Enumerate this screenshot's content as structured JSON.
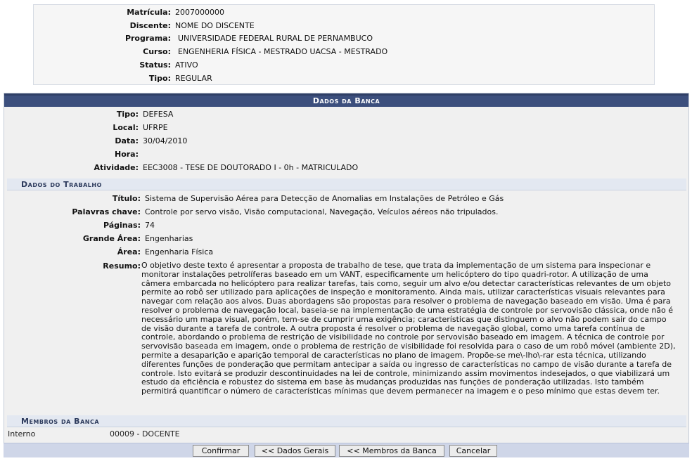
{
  "student": {
    "matricula_label": "Matrícula:",
    "matricula": "2007000000",
    "discente_label": "Discente:",
    "discente": "NOME DO DISCENTE",
    "programa_label": "Programa:",
    "programa": "UNIVERSIDADE FEDERAL RURAL DE PERNAMBUCO",
    "curso_label": "Curso:",
    "curso": "ENGENHERIA FÍSICA - MESTRADO UACSA - MESTRADO",
    "status_label": "Status:",
    "status": "ATIVO",
    "tipo_label": "Tipo:",
    "tipo": "REGULAR"
  },
  "banca": {
    "title": "Dados da Banca",
    "tipo_label": "Tipo:",
    "tipo": "DEFESA",
    "local_label": "Local:",
    "local": "UFRPE",
    "data_label": "Data:",
    "data": "30/04/2010",
    "hora_label": "Hora:",
    "hora": "",
    "atividade_label": "Atividade:",
    "atividade": "EEC3008 - TESE DE DOUTORADO I - 0h - MATRICULADO"
  },
  "trabalho": {
    "section_title": "Dados do Trabalho",
    "titulo_label": "Título:",
    "titulo": "Sistema de Supervisão Aérea para Detecção de Anomalias em Instalações de Petróleo e Gás",
    "palavras_label": "Palavras chave:",
    "palavras": "Controle por servo visão, Visão computacional, Navegação, Veículos aéreos não tripulados.",
    "paginas_label": "Páginas:",
    "paginas": "74",
    "grande_area_label": "Grande Área:",
    "grande_area": "Engenharias",
    "area_label": "Área:",
    "area": "Engenharia Física",
    "resumo_label": "Resumo:",
    "resumo": "O objetivo deste texto é apresentar a proposta de trabalho de tese, que trata da implementação de um sistema para inspecionar e monitorar instalações petrolíferas baseado em um VANT, especificamente um helicóptero do tipo quadri-rotor. A utilização de uma câmera embarcada no helicóptero para realizar tarefas, tais como, seguir um alvo e/ou detectar características relevantes de um objeto permite ao robô ser utilizado para aplicações de inspeção e monitoramento. Ainda mais, utilizar características visuais relevantes para navegar com relação aos alvos. Duas abordagens são propostas para resolver o problema de navegação baseado em visão. Uma é para resolver o problema de navegação local, baseia-se na implementação de uma estratégia de controle por servovisão clássica, onde não é necessário um mapa visual, porém, tem-se de cumprir uma exigência; características que distinguem o alvo não podem sair do campo de visão durante a tarefa de controle. A outra proposta é resolver o problema de navegação global, como uma tarefa contínua de controle, abordando o problema de restrição de visibilidade no controle por servovisão baseado em imagem. A técnica de controle por servovisão baseada em imagem, onde o problema de restrição de visibilidade foi resolvida para o caso de um robô móvel (ambiente 2D), permite a desaparição e aparição temporal de características no plano de imagem. Propõe-se me\\-lho\\-rar esta técnica, utilizando diferentes funções de ponderação que permitam antecipar a saída ou ingresso de características no campo de visão durante a tarefa de controle. Isto evitará se produzir descontinuidades na lei de controle, minimizando assim movimentos indesejados, o que viabilizará um estudo da eficiência e robustez do sistema em base às mudanças produzidas nas funções de ponderação utilizadas. Isto também permitirá quantificar o número de características mínimas que devem permanecer na imagem e o peso mínimo que estas devem ter."
  },
  "membros": {
    "section_title": "Membros da Banca",
    "rows": [
      {
        "tipo": "Interno",
        "membro": "00009 - DOCENTE"
      }
    ]
  },
  "buttons": {
    "confirmar": "Confirmar",
    "dados_gerais": "<< Dados Gerais",
    "membros_banca": "<< Membros da Banca",
    "cancelar": "Cancelar"
  }
}
